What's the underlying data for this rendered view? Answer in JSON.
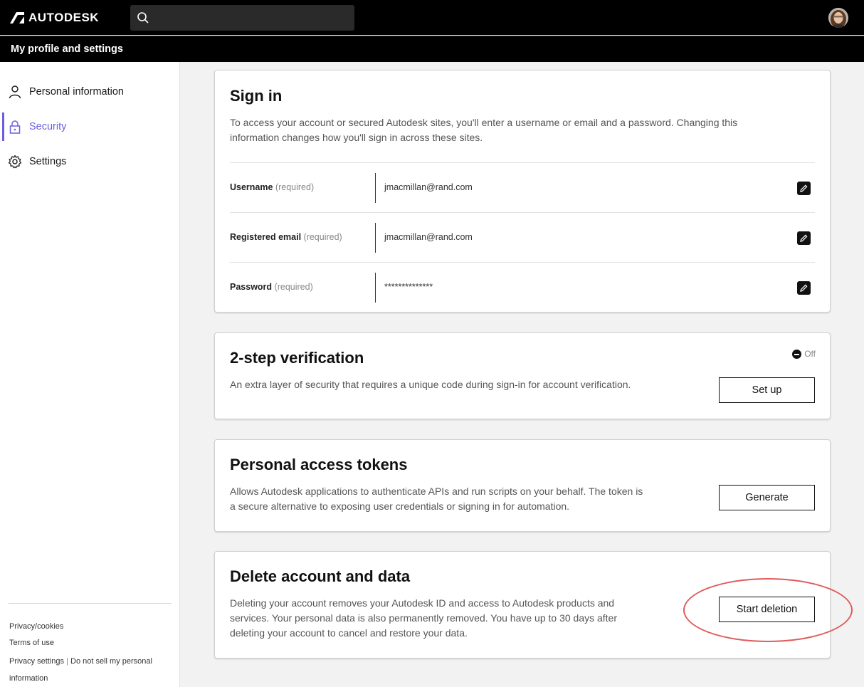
{
  "header": {
    "brand": "AUTODESK",
    "search_placeholder": "",
    "subtitle": "My profile and settings"
  },
  "sidebar": {
    "items": [
      {
        "label": "Personal information",
        "icon": "person-icon"
      },
      {
        "label": "Security",
        "icon": "lock-icon",
        "active": true
      },
      {
        "label": "Settings",
        "icon": "gear-icon"
      }
    ],
    "footer": {
      "privacy_cookies": "Privacy/cookies",
      "terms": "Terms of use",
      "privacy_settings": "Privacy settings",
      "separator": "|",
      "do_not_sell": "Do not sell my personal",
      "do_not_sell_2": "information"
    }
  },
  "signin": {
    "title": "Sign in",
    "description_1": "To access your account or secured Autodesk sites, you'll enter a username or email and a password. Changing this",
    "description_2": "information changes how you'll sign in across these sites.",
    "rows": [
      {
        "label": "Username",
        "req": "(required)",
        "value": "jmacmillan@rand.com"
      },
      {
        "label": "Registered email",
        "req": "(required)",
        "value": "jmacmillan@rand.com"
      },
      {
        "label": "Password",
        "req": "(required)",
        "value": "**************"
      }
    ]
  },
  "two_step": {
    "title": "2-step verification",
    "description": "An extra layer of security that requires a unique code during sign-in for account verification.",
    "status": "Off",
    "button": "Set up"
  },
  "tokens": {
    "title": "Personal access tokens",
    "description_1": "Allows Autodesk applications to authenticate APIs and run scripts on your behalf. The token is",
    "description_2": "a secure alternative to exposing user credentials or signing in for automation.",
    "button": "Generate"
  },
  "delete": {
    "title": "Delete account and data",
    "description_1": "Deleting your account removes your Autodesk ID and access to Autodesk products and",
    "description_2": "services. Your personal data is also permanently removed. You have up to 30 days after",
    "description_3": "deleting your account to cancel and restore your data.",
    "button": "Start deletion"
  },
  "colors": {
    "accent": "#6b5fe0",
    "annotation": "#e05a5a",
    "topbar": "#000000"
  }
}
